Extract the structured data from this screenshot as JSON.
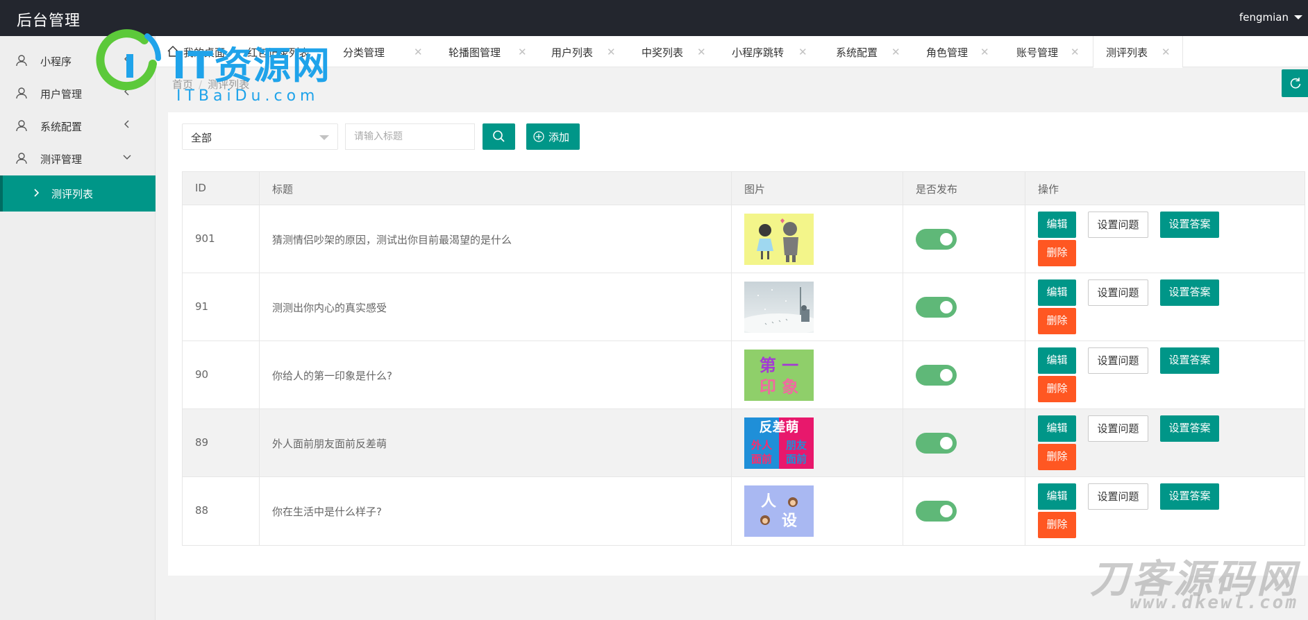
{
  "header": {
    "title": "后台管理",
    "user": "fengmian"
  },
  "sidebar": {
    "items": [
      {
        "label": "小程序",
        "arrow": "<"
      },
      {
        "label": "用户管理",
        "arrow": "<"
      },
      {
        "label": "系统配置",
        "arrow": "<"
      },
      {
        "label": "测评管理",
        "arrow": "v"
      }
    ],
    "sub_item": {
      "label": "测评列表"
    }
  },
  "tabs": [
    {
      "label": "我的桌面",
      "close": ""
    },
    {
      "label": "红包记录列表",
      "close": ""
    },
    {
      "label": "分类管理",
      "close": "✕"
    },
    {
      "label": "轮播图管理",
      "close": "✕"
    },
    {
      "label": "用户列表",
      "close": "✕"
    },
    {
      "label": "中奖列表",
      "close": "✕"
    },
    {
      "label": "小程序跳转",
      "close": "✕"
    },
    {
      "label": "系统配置",
      "close": "✕"
    },
    {
      "label": "角色管理",
      "close": "✕"
    },
    {
      "label": "账号管理",
      "close": "✕"
    },
    {
      "label": "测评列表",
      "close": "✕"
    }
  ],
  "breadcrumb": {
    "home": "首页",
    "sep": "/",
    "current": "测评列表"
  },
  "filter": {
    "select_value": "全部",
    "search_placeholder": "请输入标题",
    "add_label": "添加"
  },
  "table": {
    "headers": {
      "id": "ID",
      "title": "标题",
      "image": "图片",
      "published": "是否发布",
      "actions": "操作"
    },
    "rows": [
      {
        "id": "901",
        "title": "猜测情侣吵架的原因，测试出你目前最渴望的是什么",
        "published": true
      },
      {
        "id": "91",
        "title": "测测出你内心的真实感受",
        "published": true
      },
      {
        "id": "90",
        "title": "你给人的第一印象是什么?",
        "published": true
      },
      {
        "id": "89",
        "title": "外人面前朋友面前反差萌",
        "published": true
      },
      {
        "id": "88",
        "title": "你在生活中是什么样子?",
        "published": true
      }
    ],
    "actions": {
      "edit": "编辑",
      "set_questions": "设置问题",
      "set_answers": "设置答案",
      "delete": "删除"
    }
  },
  "thumbnails": {
    "img90": {
      "line1": "第 一",
      "line2": "印 象"
    },
    "img89": {
      "top": "反差萌",
      "left1": "外人",
      "left2": "面前",
      "right1": "朋友",
      "right2": "面前"
    },
    "img88": {
      "line1": "人",
      "line2": "设"
    }
  },
  "watermarks": {
    "top_main": "IT资源网",
    "top_sub": "ITBaiDu.com",
    "bottom_main": "刀客源码网",
    "bottom_sub": "www.dkewl.com"
  },
  "colors": {
    "primary": "#009688",
    "danger": "#ff5722",
    "toggle_on": "#5fb878",
    "header_bg": "#23262e"
  }
}
